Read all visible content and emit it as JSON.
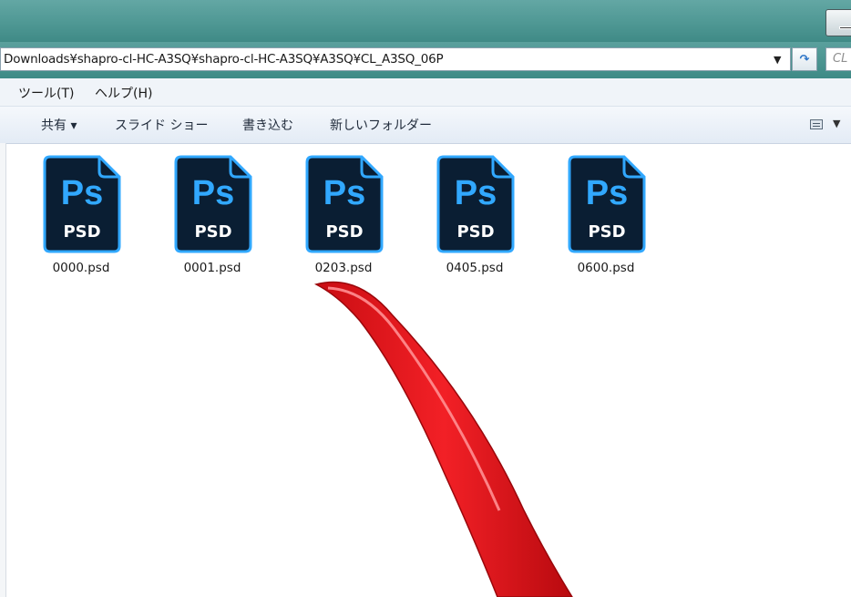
{
  "window": {
    "address_path": "Downloads¥shapro-cl-HC-A3SQ¥shapro-cl-HC-A3SQ¥A3SQ¥CL_A3SQ_06P",
    "address_dropdown_icon": "chevron-down-icon",
    "refresh_icon": "refresh-icon",
    "search_placeholder": "CL"
  },
  "menu": {
    "items": [
      {
        "label": "ツール(T)"
      },
      {
        "label": "ヘルプ(H)"
      }
    ]
  },
  "toolbar": {
    "share_label": "共有 ▾",
    "slideshow_label": "スライド ショー",
    "burn_label": "書き込む",
    "new_folder_label": "新しいフォルダー"
  },
  "files": [
    {
      "name": "0000.psd",
      "icon_text": "Ps",
      "icon_type": "PSD"
    },
    {
      "name": "0001.psd",
      "icon_text": "Ps",
      "icon_type": "PSD"
    },
    {
      "name": "0203.psd",
      "icon_text": "Ps",
      "icon_type": "PSD"
    },
    {
      "name": "0405.psd",
      "icon_text": "Ps",
      "icon_type": "PSD"
    },
    {
      "name": "0600.psd",
      "icon_text": "Ps",
      "icon_type": "PSD"
    }
  ],
  "colors": {
    "ps_icon_bg": "#0a1e33",
    "ps_icon_accent": "#31a8ff",
    "annotation_arrow": "#e8141a"
  },
  "annotation": {
    "icon": "curved-arrow-icon"
  }
}
